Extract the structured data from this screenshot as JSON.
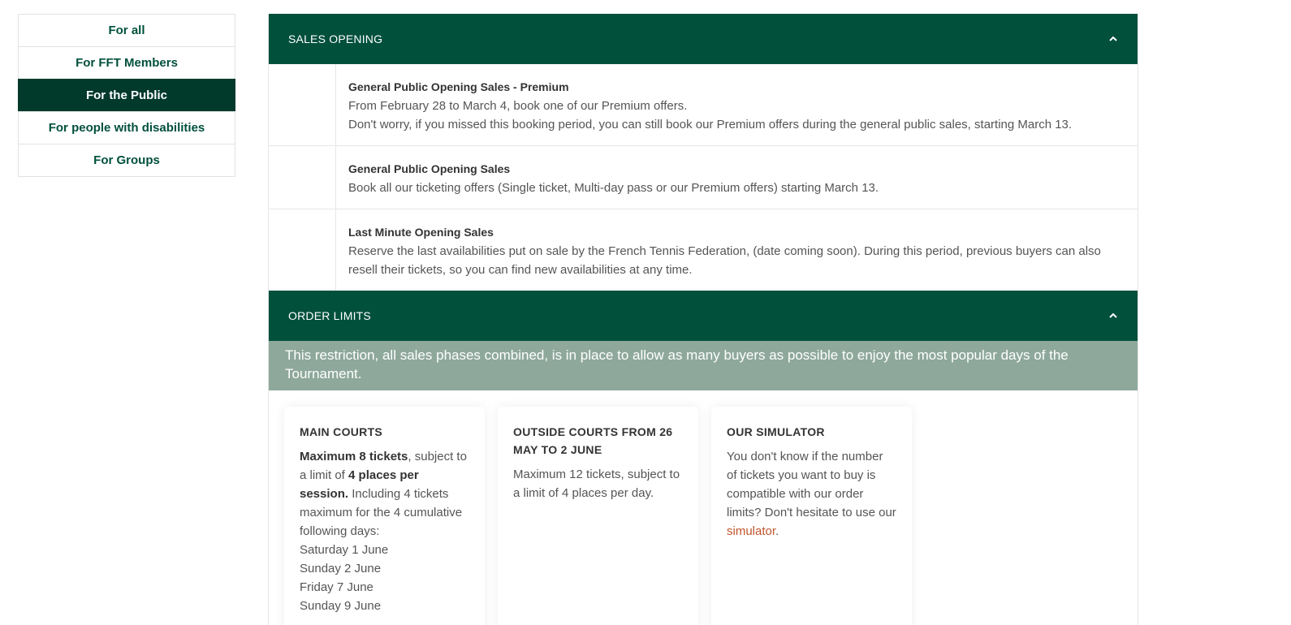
{
  "sidebar": {
    "items": [
      {
        "label": "For all",
        "active": false
      },
      {
        "label": "For FFT Members",
        "active": false
      },
      {
        "label": "For the Public",
        "active": true
      },
      {
        "label": "For people with disabilities",
        "active": false
      },
      {
        "label": "For Groups",
        "active": false
      }
    ]
  },
  "sales_opening": {
    "title": "SALES OPENING",
    "rows": [
      {
        "title": "General Public Opening Sales - Premium",
        "line1": "From February 28 to March 4, book one of our Premium offers.",
        "line2": "Don't worry, if you missed this booking period, you can still book our Premium offers during the general public sales, starting March 13."
      },
      {
        "title": "General Public Opening Sales",
        "line1": "Book all our ticketing offers (Single ticket, Multi-day pass or our Premium offers) starting March 13."
      },
      {
        "title": "Last Minute Opening Sales",
        "line1": "Reserve the last availabilities put on sale by the French Tennis Federation, (date coming soon). During this period, previous buyers can also resell their tickets, so you can find new availabilities at any time."
      }
    ]
  },
  "order_limits": {
    "title": "ORDER LIMITS",
    "notice": "This restriction, all sales phases combined, is in place to allow as many buyers as possible to enjoy the most popular days of the Tournament.",
    "cards": {
      "main": {
        "title": "MAIN COURTS",
        "bold1": "Maximum 8 tickets",
        "text1": ", subject to a limit of ",
        "bold2": "4 places per session.",
        "text2": " Including 4 tickets maximum for the 4 cumulative following days:",
        "days": [
          "Saturday 1 June",
          "Sunday 2 June",
          "Friday 7 June",
          "Sunday 9 June"
        ]
      },
      "outside": {
        "title": "OUTSIDE COURTS FROM 26 MAY TO 2 JUNE",
        "text": "Maximum 12 tickets, subject to a limit of 4 places per day."
      },
      "simulator": {
        "title": "OUR SIMULATOR",
        "text": "You don't know if the number of tickets you want to buy is compatible with our order limits? Don't hesitate to use our ",
        "link": "simulator",
        "after": "."
      }
    }
  },
  "colors": {
    "brand_green": "#00503c",
    "active_green": "#01392b",
    "notice_green": "#8ea89c",
    "link": "#c0552d"
  },
  "icons": {
    "accordion": "chevron-up-icon"
  }
}
